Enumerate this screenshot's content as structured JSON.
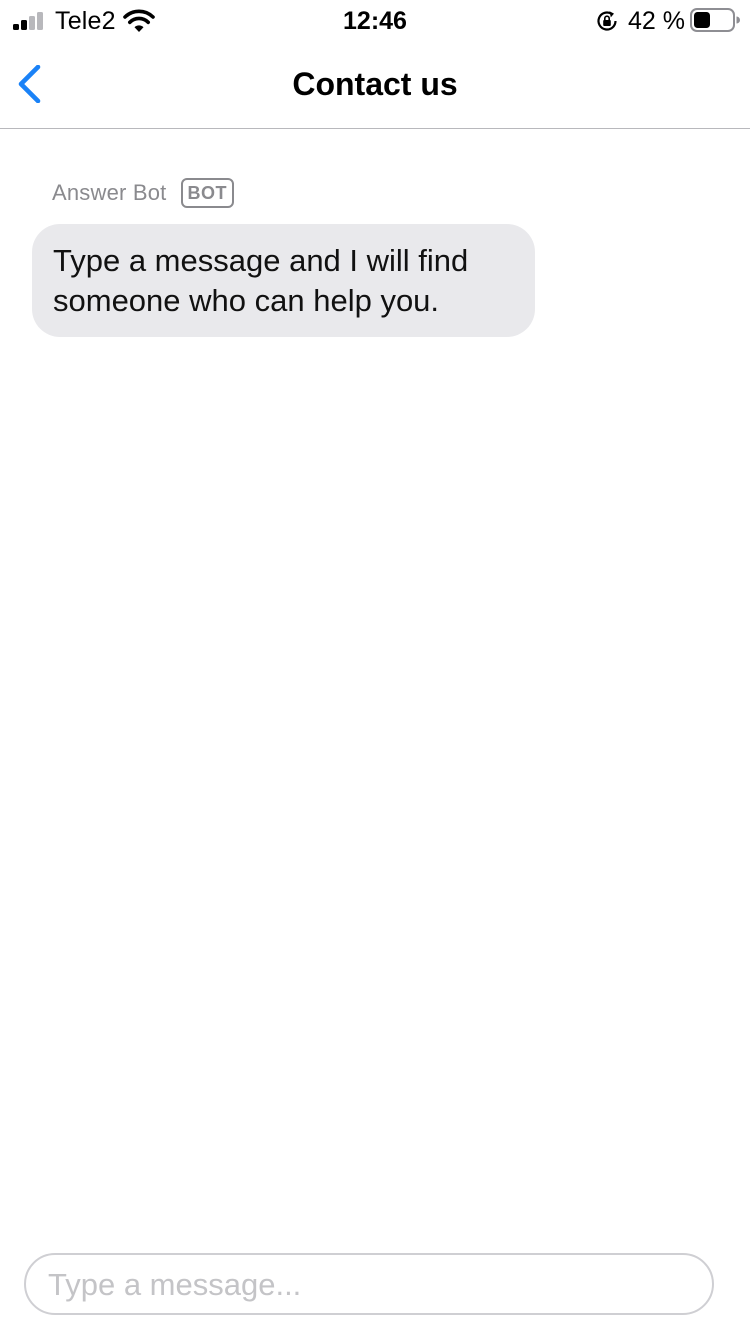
{
  "status_bar": {
    "carrier": "Tele2",
    "time": "12:46",
    "battery_percent": "42 %",
    "battery_level": 0.42,
    "signal_bars_active": 2,
    "signal_bars_total": 4,
    "icons": [
      "signal-icon",
      "wifi-icon",
      "rotation-lock-icon",
      "battery-icon"
    ]
  },
  "nav": {
    "title": "Contact us",
    "back_icon": "chevron-left-icon"
  },
  "messages": [
    {
      "sender": "Answer Bot",
      "badge": "BOT",
      "text": "Type a message and I will find someone who can help you."
    }
  ],
  "composer": {
    "value": "",
    "placeholder": "Type a message..."
  },
  "colors": {
    "accent": "#1a82f7",
    "bubble": "#e9e9ec",
    "secondary_text": "#8a8a8e",
    "divider": "#b8b8bc"
  }
}
